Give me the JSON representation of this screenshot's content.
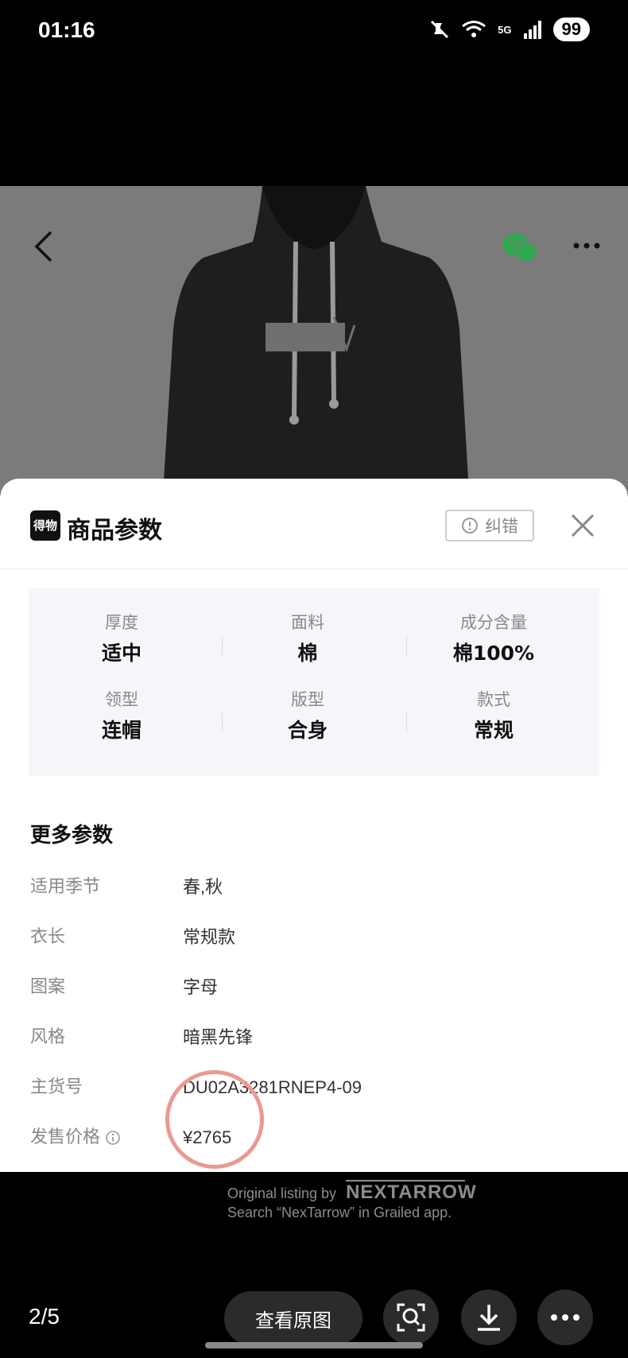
{
  "status_bar": {
    "time": "01:16",
    "network": "5G",
    "battery": "99"
  },
  "colors": {
    "accent_wechat": "#2fa84f",
    "highlight_circle": "#e99a92",
    "sheet_bg": "#ffffff",
    "grid_bg": "#f5f6fa"
  },
  "sheet": {
    "logo_text": "得物",
    "title": "商品参数",
    "report_label": "纠错",
    "attributes": [
      {
        "label": "厚度",
        "value": "适中"
      },
      {
        "label": "面料",
        "value": "棉"
      },
      {
        "label": "成分含量",
        "value": "棉100%"
      },
      {
        "label": "领型",
        "value": "连帽"
      },
      {
        "label": "版型",
        "value": "合身"
      },
      {
        "label": "款式",
        "value": "常规"
      }
    ],
    "more_title": "更多参数",
    "more_params": [
      {
        "key": "适用季节",
        "value": "春,秋"
      },
      {
        "key": "衣长",
        "value": "常规款"
      },
      {
        "key": "图案",
        "value": "字母"
      },
      {
        "key": "风格",
        "value": "暗黑先锋"
      },
      {
        "key": "主货号",
        "value": "DU02A3281RNEP4-09"
      },
      {
        "key": "发售价格",
        "value": "¥2765"
      }
    ]
  },
  "watermark": {
    "line1": "Original listing by",
    "brand": "NEXTARROW",
    "line2": "Search “NexTarrow” in Grailed app."
  },
  "viewer": {
    "counter": "2/5",
    "view_original_label": "查看原图"
  }
}
